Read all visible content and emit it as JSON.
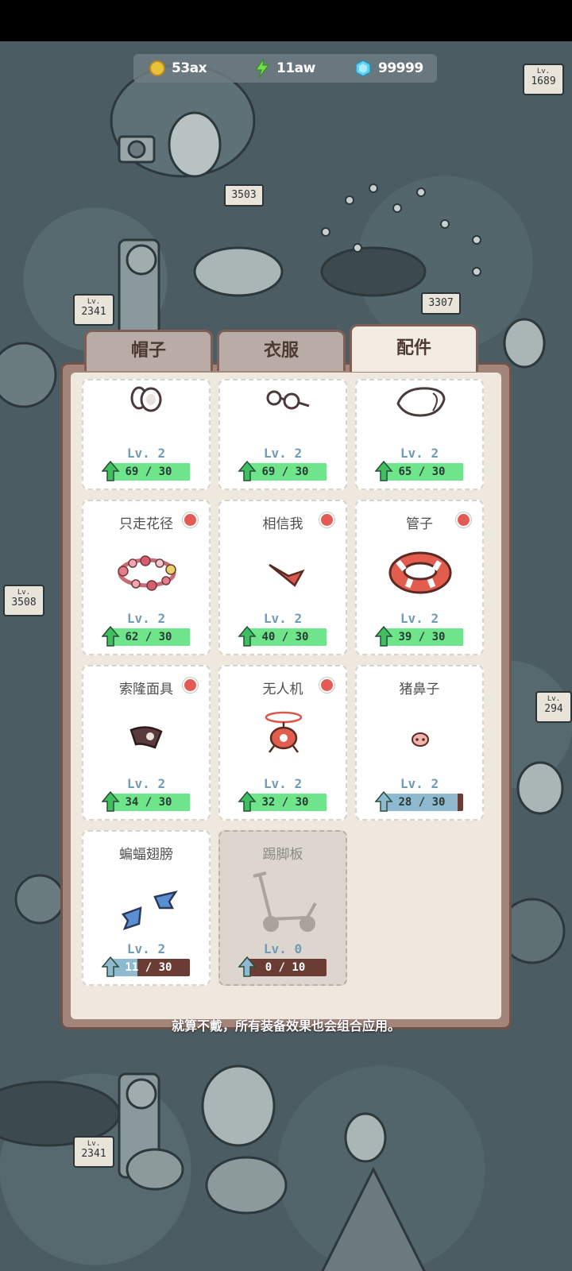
{
  "currency": {
    "coins": "53ax",
    "energy": "11aw",
    "gems": "99999"
  },
  "tabs": [
    {
      "label": "帽子"
    },
    {
      "label": "衣服"
    },
    {
      "label": "配件"
    }
  ],
  "active_tab": "配件",
  "items": [
    {
      "name": "",
      "level": "Lv. 2",
      "progress": "69 / 30",
      "ratio": 1.0,
      "new": false,
      "icon": "goggles-icon"
    },
    {
      "name": "",
      "level": "Lv. 2",
      "progress": "69 / 30",
      "ratio": 1.0,
      "new": false,
      "icon": "glasses-icon"
    },
    {
      "name": "",
      "level": "Lv. 2",
      "progress": "65 / 30",
      "ratio": 1.0,
      "new": false,
      "icon": "mask-icon"
    },
    {
      "name": "只走花径",
      "level": "Lv. 2",
      "progress": "62 / 30",
      "ratio": 1.0,
      "new": true,
      "icon": "flower-wreath-icon"
    },
    {
      "name": "相信我",
      "level": "Lv. 2",
      "progress": "40 / 30",
      "ratio": 1.0,
      "new": true,
      "icon": "mustache-icon"
    },
    {
      "name": "管子",
      "level": "Lv. 2",
      "progress": "39 / 30",
      "ratio": 1.0,
      "new": true,
      "icon": "swim-ring-icon"
    },
    {
      "name": "索隆面具",
      "level": "Lv. 2",
      "progress": "34 / 30",
      "ratio": 1.0,
      "new": true,
      "icon": "eye-mask-icon"
    },
    {
      "name": "无人机",
      "level": "Lv. 2",
      "progress": "32 / 30",
      "ratio": 1.0,
      "new": true,
      "icon": "drone-icon"
    },
    {
      "name": "猪鼻子",
      "level": "Lv. 2",
      "progress": "28 / 30",
      "ratio": 0.93,
      "new": false,
      "icon": "pig-nose-icon"
    },
    {
      "name": "蝙蝠翅膀",
      "level": "Lv. 2",
      "progress": "11 / 30",
      "ratio": 0.37,
      "new": false,
      "icon": "bat-wings-icon"
    },
    {
      "name": "踢脚板",
      "level": "Lv. 0",
      "progress": "0 / 10",
      "ratio": 0.0,
      "new": false,
      "locked": true,
      "icon": "scooter-icon"
    }
  ],
  "tip": "就算不戴，所有装备效果也会组合应用。",
  "signs": [
    "1689",
    "3503",
    "3307",
    "2341",
    "3508",
    "294",
    "2341"
  ],
  "colors": {
    "progress_full": "#6ee48b",
    "progress_partial": "#8fb9cf",
    "progress_track": "#6a3c34",
    "new_dot": "#e25b55",
    "level_text": "#6f9bb3"
  }
}
